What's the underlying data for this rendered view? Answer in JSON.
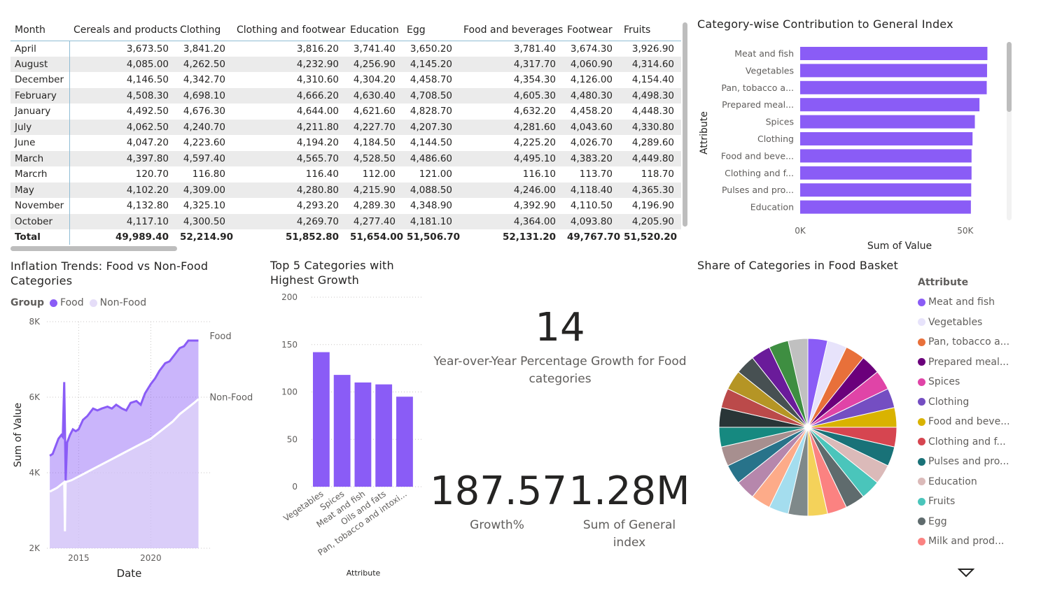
{
  "table": {
    "columns": [
      "Month",
      "Cereals and products",
      "Clothing",
      "Clothing and footwear",
      "Education",
      "Egg",
      "Food and beverages",
      "Footwear",
      "Fruits"
    ],
    "rows": [
      [
        "April",
        "3,673.50",
        "3,841.20",
        "3,816.20",
        "3,741.40",
        "3,650.20",
        "3,781.40",
        "3,674.30",
        "3,926.90"
      ],
      [
        "August",
        "4,085.00",
        "4,262.50",
        "4,232.90",
        "4,256.90",
        "4,145.20",
        "4,317.70",
        "4,060.90",
        "4,314.60"
      ],
      [
        "December",
        "4,146.50",
        "4,342.70",
        "4,310.60",
        "4,304.20",
        "4,458.70",
        "4,354.30",
        "4,126.00",
        "4,154.40"
      ],
      [
        "February",
        "4,508.30",
        "4,698.10",
        "4,666.20",
        "4,630.40",
        "4,708.50",
        "4,605.30",
        "4,480.30",
        "4,498.30"
      ],
      [
        "January",
        "4,492.50",
        "4,676.30",
        "4,644.00",
        "4,621.60",
        "4,828.70",
        "4,632.20",
        "4,458.20",
        "4,448.30"
      ],
      [
        "July",
        "4,062.50",
        "4,240.70",
        "4,211.80",
        "4,227.70",
        "4,207.30",
        "4,281.60",
        "4,043.60",
        "4,330.80"
      ],
      [
        "June",
        "4,047.20",
        "4,223.60",
        "4,194.20",
        "4,184.50",
        "4,144.50",
        "4,225.20",
        "4,026.70",
        "4,289.60"
      ],
      [
        "March",
        "4,397.80",
        "4,597.40",
        "4,565.70",
        "4,528.50",
        "4,486.60",
        "4,495.10",
        "4,383.20",
        "4,449.80"
      ],
      [
        "Marcrh",
        "120.70",
        "116.80",
        "116.40",
        "112.00",
        "121.00",
        "116.10",
        "113.70",
        "118.70"
      ],
      [
        "May",
        "4,102.20",
        "4,309.00",
        "4,280.80",
        "4,215.90",
        "4,088.50",
        "4,246.00",
        "4,118.40",
        "4,365.30"
      ],
      [
        "November",
        "4,132.80",
        "4,325.10",
        "4,293.20",
        "4,289.30",
        "4,348.90",
        "4,392.90",
        "4,110.50",
        "4,196.90"
      ],
      [
        "October",
        "4,117.10",
        "4,300.50",
        "4,269.70",
        "4,277.40",
        "4,181.10",
        "4,364.00",
        "4,093.80",
        "4,205.90"
      ]
    ],
    "total": [
      "Total",
      "49,989.40",
      "52,214.90",
      "51,852.80",
      "51,654.00",
      "51,506.70",
      "52,131.20",
      "49,767.70",
      "51,520.20"
    ]
  },
  "bar_chart": {
    "title": "Category-wise Contribution to General Index",
    "ylabel": "Attribute",
    "xlabel": "Sum of Value",
    "color": "#8a5cf6"
  },
  "line_chart": {
    "title": "Inflation Trends: Food vs Non-Food Categories",
    "legend_title": "Group",
    "food_color": "#8a5cf6",
    "nonfood_color": "#e5ddf8",
    "xlabel": "Date",
    "ylabel": "Sum of Value"
  },
  "top5": {
    "title": "Top 5 Categories with Highest Growth",
    "xlabel": "Attribute"
  },
  "cards": {
    "count_value": "14",
    "count_caption": "Year-over-Year Percentage Growth for Food categories",
    "growth_value": "187.57",
    "growth_caption": "Growth%",
    "sum_value": "1.28M",
    "sum_caption": "Sum of General index"
  },
  "pie": {
    "title": "Share of Categories in Food Basket",
    "legend_title": "Attribute"
  },
  "chart_data": [
    {
      "type": "bar",
      "orientation": "horizontal",
      "title": "Category-wise Contribution to General Index",
      "categories": [
        "Meat and fish",
        "Vegetables",
        "Pan, tobacco a...",
        "Prepared meal...",
        "Spices",
        "Clothing",
        "Food and beve...",
        "Clothing and f...",
        "Pulses and pro...",
        "Education"
      ],
      "values": [
        56700,
        56600,
        56500,
        54300,
        52900,
        52200,
        51900,
        51900,
        51800,
        51700
      ],
      "xlabel": "Sum of Value",
      "ylabel": "Attribute",
      "xticks": [
        "0K",
        "50K"
      ],
      "xlim": [
        0,
        60000
      ],
      "grid": false
    },
    {
      "type": "area",
      "title": "Inflation Trends: Food vs Non-Food Categories",
      "xlabel": "Date",
      "ylabel": "Sum of Value",
      "ylim": [
        2000,
        8000
      ],
      "yticks": [
        "2K",
        "4K",
        "6K",
        "8K"
      ],
      "xticks": [
        "2015",
        "2020"
      ],
      "legend": "top-left",
      "series": [
        {
          "name": "Food",
          "x": [
            2013.0,
            2013.2,
            2013.4,
            2013.6,
            2013.8,
            2013.9,
            2014.0,
            2014.05,
            2014.1,
            2014.2,
            2014.4,
            2014.6,
            2014.8,
            2015.0,
            2015.3,
            2015.6,
            2016.0,
            2016.3,
            2016.6,
            2017.0,
            2017.3,
            2017.6,
            2018.0,
            2018.3,
            2018.6,
            2019.0,
            2019.3,
            2019.6,
            2020.0,
            2020.3,
            2020.6,
            2021.0,
            2021.3,
            2021.6,
            2022.0,
            2022.3,
            2022.6,
            2023.0,
            2023.3
          ],
          "values": [
            4450,
            4500,
            4700,
            4900,
            5000,
            4950,
            6400,
            5200,
            3800,
            4800,
            5000,
            5150,
            5100,
            5150,
            5400,
            5500,
            5700,
            5650,
            5700,
            5750,
            5700,
            5800,
            5700,
            5650,
            5850,
            5900,
            5800,
            6100,
            6350,
            6500,
            6700,
            6900,
            6950,
            7100,
            7300,
            7350,
            7500,
            7500,
            7500
          ]
        },
        {
          "name": "Non-Food",
          "x": [
            2013.0,
            2013.5,
            2014.0,
            2014.05,
            2014.1,
            2014.5,
            2015.0,
            2015.5,
            2016.0,
            2016.5,
            2017.0,
            2017.5,
            2018.0,
            2018.5,
            2019.0,
            2019.5,
            2020.0,
            2020.5,
            2021.0,
            2021.5,
            2022.0,
            2022.5,
            2023.0,
            2023.3
          ],
          "values": [
            3500,
            3600,
            3750,
            2450,
            3750,
            3800,
            3900,
            4000,
            4100,
            4200,
            4300,
            4400,
            4500,
            4600,
            4700,
            4800,
            4900,
            5050,
            5200,
            5350,
            5550,
            5700,
            5850,
            5950
          ]
        }
      ]
    },
    {
      "type": "bar",
      "title": "Top 5 Categories with Highest Growth",
      "xlabel": "Attribute",
      "categories": [
        "Vegetables",
        "Spices",
        "Meat and fish",
        "Oils and fats",
        "Pan, tobacco and intoxi..."
      ],
      "values": [
        142,
        118,
        110,
        108,
        95
      ],
      "ylim": [
        0,
        200
      ],
      "yticks": [
        "0",
        "50",
        "100",
        "150",
        "200"
      ],
      "grid": true
    },
    {
      "type": "pie",
      "title": "Share of Categories in Food Basket",
      "legend_title": "Attribute",
      "legend": "right",
      "categories": [
        "Meat and fish",
        "Vegetables",
        "Pan, tobacco a...",
        "Prepared meal...",
        "Spices",
        "Clothing",
        "Food and beve...",
        "Clothing and f...",
        "Pulses and pro...",
        "Education",
        "Fruits",
        "Egg",
        "Milk and prod..."
      ],
      "values": [
        1,
        1,
        1,
        1,
        1,
        1,
        1,
        1,
        1,
        1,
        1,
        1,
        1,
        1,
        1,
        1,
        1,
        1,
        1,
        1,
        1,
        1,
        1,
        1,
        1,
        1,
        1,
        1
      ],
      "colors": [
        "#8a5cf6",
        "#e7e3fb",
        "#e8703a",
        "#6b007b",
        "#e044a7",
        "#744ec2",
        "#d9b300",
        "#d64550",
        "#197278",
        "#dbbab9",
        "#4ac5bb",
        "#5f6b6d",
        "#fb8281",
        "#f4d25a",
        "#7f898a",
        "#a4ddee",
        "#fdab89",
        "#b687ac",
        "#28738a",
        "#a78f8f",
        "#168980",
        "#293537",
        "#bb4a4a",
        "#b59525",
        "#475052",
        "#6a1b9a",
        "#3e8e41",
        "#c0c0c0"
      ]
    }
  ]
}
